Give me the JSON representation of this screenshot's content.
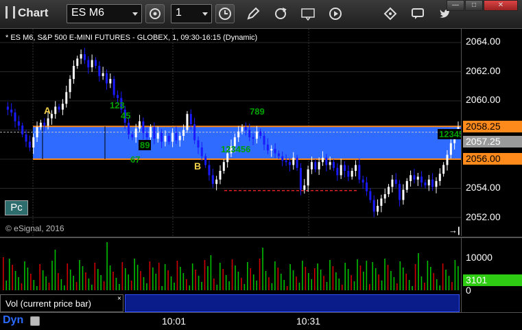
{
  "toolbar": {
    "title": "Chart",
    "symbol": "ES M6",
    "interval": "1",
    "icons": [
      "settings-gear-icon",
      "clock-icon",
      "pencil-icon",
      "refresh-icon",
      "get-icon",
      "play-icon",
      "diamond-tool-icon",
      "comment-icon",
      "twitter-icon"
    ],
    "window_buttons": [
      "—",
      "□",
      "✕"
    ]
  },
  "chart": {
    "header": "* ES M6, S&P 500 E-MINI FUTURES - GLOBEX, 1, 09:30-16:15 (Dynamic)",
    "copyright": "© eSignal, 2016",
    "badge": "Pc",
    "scroll_icon": "→|",
    "annotation_a": "A",
    "annotation_b": "B",
    "price_ticks": [
      "2064.00",
      "2062.00",
      "2060.00",
      "2058.00",
      "2056.00",
      "2054.00",
      "2052.00"
    ],
    "price_labels": [
      {
        "value": "2058.25",
        "color": "#ff8a1c"
      },
      {
        "value": "2057.25",
        "color": "#9a9a9a"
      },
      {
        "value": "2056.00",
        "color": "#ff8a1c"
      }
    ],
    "seq_labels": [
      {
        "text": "123",
        "color": "#00a000"
      },
      {
        "text": "45",
        "color": "#00a000"
      },
      {
        "text": "89",
        "color": "#00a000"
      },
      {
        "text": "67",
        "color": "#00a000"
      },
      {
        "text": "123456",
        "color": "#00a000"
      },
      {
        "text": "789",
        "color": "#00a000"
      },
      {
        "text": "12345",
        "color": "#00a000"
      }
    ],
    "zone": {
      "top": 2058.25,
      "bottom": 2056.0,
      "color": "#2f6bff",
      "line_color": "#ff8a1c"
    }
  },
  "volume": {
    "legend": "Vol (current price bar)",
    "close": "×",
    "ticks": [
      "10000",
      "0"
    ],
    "last": "3101",
    "colors": {
      "up": "#00c000",
      "down": "#d00000"
    }
  },
  "time_axis": {
    "dyn_label": "Dyn",
    "ticks": [
      "10:01",
      "10:31"
    ]
  },
  "colors": {
    "up_candle": "#ffffff",
    "down_candle": "#1a1aff",
    "grid": "#333333"
  }
}
